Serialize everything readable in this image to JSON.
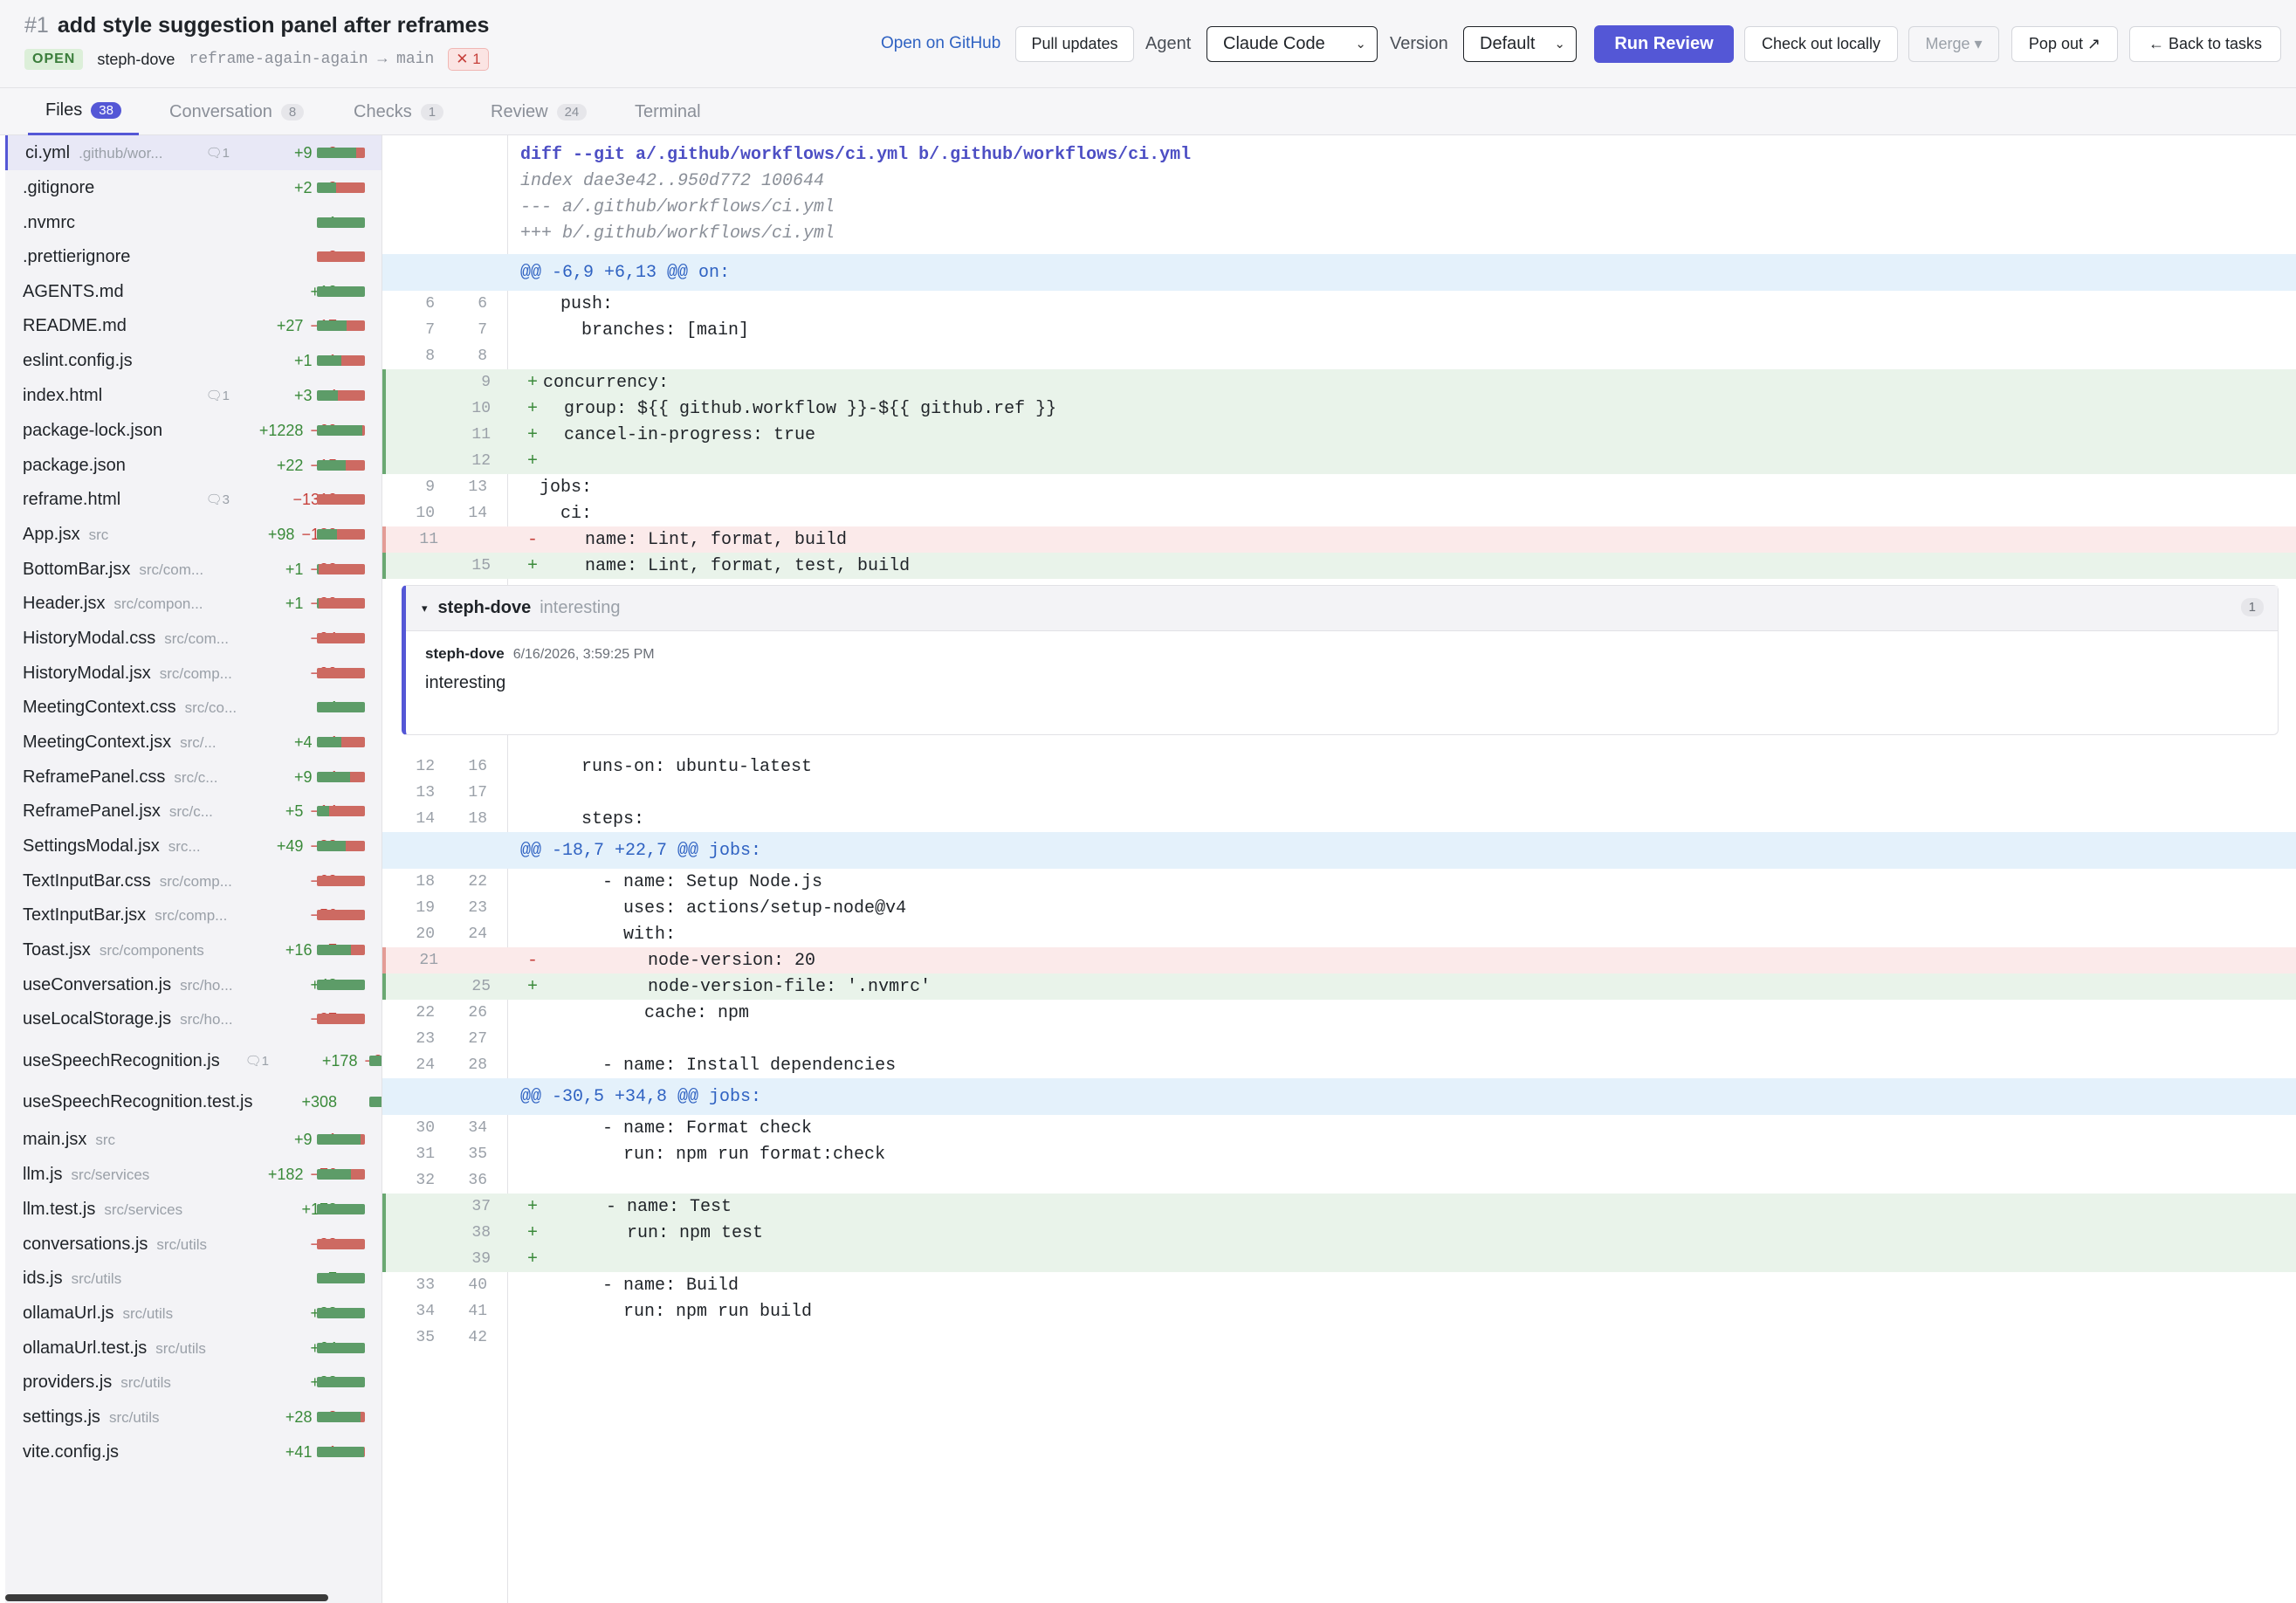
{
  "pr": {
    "number": "#1",
    "title": "add style suggestion panel after reframes",
    "status": "OPEN",
    "author": "steph-dove",
    "branch": "reframe-again-again → main",
    "fail_badge": "✕ 1"
  },
  "toolbar": {
    "open_github": "Open on GitHub",
    "pull_updates": "Pull updates",
    "agent_label": "Agent",
    "agent_value": "Claude Code",
    "version_label": "Version",
    "version_value": "Default",
    "run_review": "Run Review",
    "check_out": "Check out locally",
    "merge": "Merge ▾",
    "pop_out": "Pop out ↗",
    "back": "← Back to tasks"
  },
  "tabs": [
    {
      "label": "Files",
      "count": "38"
    },
    {
      "label": "Conversation",
      "count": "8"
    },
    {
      "label": "Checks",
      "count": "1"
    },
    {
      "label": "Review",
      "count": "24"
    },
    {
      "label": "Terminal",
      "count": ""
    }
  ],
  "files": [
    {
      "name": "ci.yml",
      "dir": ".github/wor...",
      "comments": "1",
      "add": "+9",
      "del": "−2",
      "g": 0.82
    },
    {
      "name": ".gitignore",
      "dir": "",
      "comments": "",
      "add": "+2",
      "del": "−3",
      "g": 0.4
    },
    {
      "name": ".nvmrc",
      "dir": "",
      "comments": "",
      "add": "+1",
      "del": "",
      "g": 1
    },
    {
      "name": ".prettierignore",
      "dir": "",
      "comments": "",
      "add": "",
      "del": "−3",
      "g": 0
    },
    {
      "name": "AGENTS.md",
      "dir": "",
      "comments": "",
      "add": "+10",
      "del": "",
      "g": 1
    },
    {
      "name": "README.md",
      "dir": "",
      "comments": "",
      "add": "+27",
      "del": "−17",
      "g": 0.61
    },
    {
      "name": "eslint.config.js",
      "dir": "",
      "comments": "",
      "add": "+1",
      "del": "−1",
      "g": 0.5
    },
    {
      "name": "index.html",
      "dir": "",
      "comments": "1",
      "add": "+3",
      "del": "−4",
      "g": 0.43
    },
    {
      "name": "package-lock.json",
      "dir": "",
      "comments": "",
      "add": "+1228",
      "del": "−69",
      "g": 0.95
    },
    {
      "name": "package.json",
      "dir": "",
      "comments": "",
      "add": "+22",
      "del": "−15",
      "g": 0.6
    },
    {
      "name": "reframe.html",
      "dir": "",
      "comments": "3",
      "add": "",
      "del": "−1310",
      "g": 0
    },
    {
      "name": "App.jsx",
      "dir": "src",
      "comments": "",
      "add": "+98",
      "del": "−139",
      "g": 0.41
    },
    {
      "name": "BottomBar.jsx",
      "dir": "src/com...",
      "comments": "",
      "add": "+1",
      "del": "−33",
      "g": 0.03
    },
    {
      "name": "Header.jsx",
      "dir": "src/compon...",
      "comments": "",
      "add": "+1",
      "del": "−29",
      "g": 0.03
    },
    {
      "name": "HistoryModal.css",
      "dir": "src/com...",
      "comments": "",
      "add": "",
      "del": "−94",
      "g": 0
    },
    {
      "name": "HistoryModal.jsx",
      "dir": "src/comp...",
      "comments": "",
      "add": "",
      "del": "−99",
      "g": 0
    },
    {
      "name": "MeetingContext.css",
      "dir": "src/co...",
      "comments": "",
      "add": "+4",
      "del": "",
      "g": 1
    },
    {
      "name": "MeetingContext.jsx",
      "dir": "src/...",
      "comments": "",
      "add": "+4",
      "del": "−4",
      "g": 0.5
    },
    {
      "name": "ReframePanel.css",
      "dir": "src/c...",
      "comments": "",
      "add": "+9",
      "del": "−4",
      "g": 0.69
    },
    {
      "name": "ReframePanel.jsx",
      "dir": "src/c...",
      "comments": "",
      "add": "+5",
      "del": "−14",
      "g": 0.26
    },
    {
      "name": "SettingsModal.jsx",
      "dir": "src...",
      "comments": "",
      "add": "+49",
      "del": "−32",
      "g": 0.6
    },
    {
      "name": "TextInputBar.css",
      "dir": "src/comp...",
      "comments": "",
      "add": "",
      "del": "−60",
      "g": 0
    },
    {
      "name": "TextInputBar.jsx",
      "dir": "src/comp...",
      "comments": "",
      "add": "",
      "del": "−56",
      "g": 0
    },
    {
      "name": "Toast.jsx",
      "dir": "src/components",
      "comments": "",
      "add": "+16",
      "del": "−7",
      "g": 0.7
    },
    {
      "name": "useConversation.js",
      "dir": "src/ho...",
      "comments": "",
      "add": "+48",
      "del": "",
      "g": 1
    },
    {
      "name": "useLocalStorage.js",
      "dir": "src/ho...",
      "comments": "",
      "add": "",
      "del": "−27",
      "g": 0
    },
    {
      "name": "useSpeechRecognition.js",
      "dir": "",
      "comments": "1",
      "add": "+178",
      "del": "−34",
      "g": 0.84
    },
    {
      "name": "useSpeechRecognition.test.js",
      "dir": "",
      "comments": "",
      "add": "+308",
      "del": "",
      "g": 1
    },
    {
      "name": "main.jsx",
      "dir": "src",
      "comments": "",
      "add": "+9",
      "del": "−1",
      "g": 0.9
    },
    {
      "name": "llm.js",
      "dir": "src/services",
      "comments": "",
      "add": "+182",
      "del": "−76",
      "g": 0.7
    },
    {
      "name": "llm.test.js",
      "dir": "src/services",
      "comments": "",
      "add": "+178",
      "del": "",
      "g": 1
    },
    {
      "name": "conversations.js",
      "dir": "src/utils",
      "comments": "",
      "add": "",
      "del": "−88",
      "g": 0
    },
    {
      "name": "ids.js",
      "dir": "src/utils",
      "comments": "",
      "add": "+7",
      "del": "",
      "g": 1
    },
    {
      "name": "ollamaUrl.js",
      "dir": "src/utils",
      "comments": "",
      "add": "+23",
      "del": "",
      "g": 1
    },
    {
      "name": "ollamaUrl.test.js",
      "dir": "src/utils",
      "comments": "",
      "add": "+64",
      "del": "",
      "g": 1
    },
    {
      "name": "providers.js",
      "dir": "src/utils",
      "comments": "",
      "add": "+22",
      "del": "",
      "g": 1
    },
    {
      "name": "settings.js",
      "dir": "src/utils",
      "comments": "",
      "add": "+28",
      "del": "−3",
      "g": 0.9
    },
    {
      "name": "vite.config.js",
      "dir": "",
      "comments": "",
      "add": "+41",
      "del": "−1",
      "g": 0.98
    }
  ],
  "diff_header": [
    "diff --git a/.github/workflows/ci.yml b/.github/workflows/ci.yml",
    "index dae3e42..950d772 100644",
    "--- a/.github/workflows/ci.yml",
    "+++ b/.github/workflows/ci.yml"
  ],
  "diff_lines": [
    {
      "t": "hunk",
      "code": "@@ -6,9 +6,13 @@ on:"
    },
    {
      "t": "ctx",
      "a": "6",
      "b": "6",
      "code": "  push:"
    },
    {
      "t": "ctx",
      "a": "7",
      "b": "7",
      "code": "    branches: [main]"
    },
    {
      "t": "ctx",
      "a": "8",
      "b": "8",
      "code": ""
    },
    {
      "t": "add",
      "a": "",
      "b": "9",
      "code": "concurrency:"
    },
    {
      "t": "add",
      "a": "",
      "b": "10",
      "code": "  group: ${{ github.workflow }}-${{ github.ref }}"
    },
    {
      "t": "add",
      "a": "",
      "b": "11",
      "code": "  cancel-in-progress: true"
    },
    {
      "t": "add",
      "a": "",
      "b": "12",
      "code": ""
    },
    {
      "t": "ctx",
      "a": "9",
      "b": "13",
      "code": "jobs:"
    },
    {
      "t": "ctx",
      "a": "10",
      "b": "14",
      "code": "  ci:"
    },
    {
      "t": "del",
      "a": "11",
      "b": "",
      "code": "    name: Lint, format, build"
    },
    {
      "t": "add",
      "a": "",
      "b": "15",
      "code": "    name: Lint, format, test, build"
    },
    {
      "t": "comment"
    },
    {
      "t": "ctx",
      "a": "12",
      "b": "16",
      "code": "    runs-on: ubuntu-latest"
    },
    {
      "t": "ctx",
      "a": "13",
      "b": "17",
      "code": ""
    },
    {
      "t": "ctx",
      "a": "14",
      "b": "18",
      "code": "    steps:"
    },
    {
      "t": "hunk",
      "code": "@@ -18,7 +22,7 @@ jobs:"
    },
    {
      "t": "ctx",
      "a": "18",
      "b": "22",
      "code": "      - name: Setup Node.js"
    },
    {
      "t": "ctx",
      "a": "19",
      "b": "23",
      "code": "        uses: actions/setup-node@v4"
    },
    {
      "t": "ctx",
      "a": "20",
      "b": "24",
      "code": "        with:"
    },
    {
      "t": "del",
      "a": "21",
      "b": "",
      "code": "          node-version: 20"
    },
    {
      "t": "add",
      "a": "",
      "b": "25",
      "code": "          node-version-file: '.nvmrc'"
    },
    {
      "t": "ctx",
      "a": "22",
      "b": "26",
      "code": "          cache: npm"
    },
    {
      "t": "ctx",
      "a": "23",
      "b": "27",
      "code": ""
    },
    {
      "t": "ctx",
      "a": "24",
      "b": "28",
      "code": "      - name: Install dependencies"
    },
    {
      "t": "hunk",
      "code": "@@ -30,5 +34,8 @@ jobs:"
    },
    {
      "t": "ctx",
      "a": "30",
      "b": "34",
      "code": "      - name: Format check"
    },
    {
      "t": "ctx",
      "a": "31",
      "b": "35",
      "code": "        run: npm run format:check"
    },
    {
      "t": "ctx",
      "a": "32",
      "b": "36",
      "code": ""
    },
    {
      "t": "add",
      "a": "",
      "b": "37",
      "code": "      - name: Test"
    },
    {
      "t": "add",
      "a": "",
      "b": "38",
      "code": "        run: npm test"
    },
    {
      "t": "add",
      "a": "",
      "b": "39",
      "code": ""
    },
    {
      "t": "ctx",
      "a": "33",
      "b": "40",
      "code": "      - name: Build"
    },
    {
      "t": "ctx",
      "a": "34",
      "b": "41",
      "code": "        run: npm run build"
    },
    {
      "t": "ctx",
      "a": "35",
      "b": "42",
      "code": ""
    }
  ],
  "comment": {
    "thread_author": "steph-dove",
    "preview": "interesting",
    "count": "1",
    "author": "steph-dove",
    "date": "6/16/2026, 3:59:25 PM",
    "text": "interesting"
  }
}
